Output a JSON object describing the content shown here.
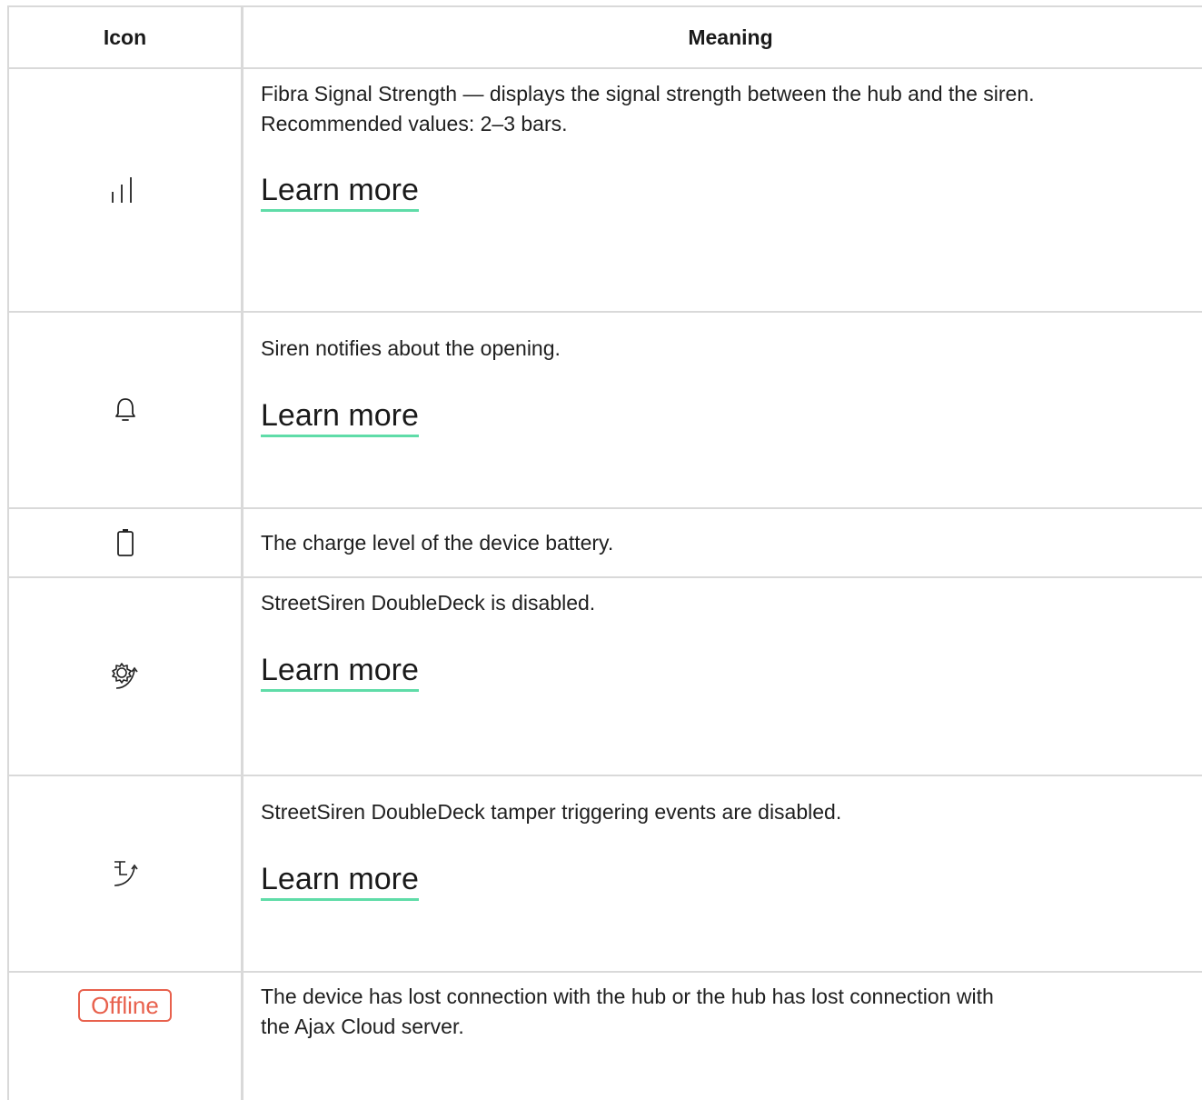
{
  "table": {
    "headers": {
      "icon": "Icon",
      "meaning": "Meaning"
    },
    "rows": [
      {
        "icon_name": "signal-strength-icon",
        "text_lines": [
          "Fibra Signal Strength — displays the signal strength between the hub and the siren.",
          "Recommended values: 2–3 bars."
        ],
        "link": "Learn more"
      },
      {
        "icon_name": "bell-icon",
        "text_lines": [
          "Siren notifies about the opening."
        ],
        "link": "Learn more"
      },
      {
        "icon_name": "battery-icon",
        "text_lines": [
          "The charge level of the device battery."
        ]
      },
      {
        "icon_name": "gear-disabled-icon",
        "text_lines": [
          "StreetSiren DoubleDeck is disabled."
        ],
        "link": "Learn more"
      },
      {
        "icon_name": "tamper-disabled-icon",
        "text_lines": [
          "StreetSiren DoubleDeck tamper triggering events are disabled."
        ],
        "link": "Learn more"
      },
      {
        "icon_name": "offline-badge",
        "badge": "Offline",
        "text_lines": [
          "The device has lost connection with the hub or the hub has lost connection with",
          "the Ajax Cloud server."
        ]
      }
    ]
  },
  "colors": {
    "border": "#d9d9d9",
    "link_underline": "#5fdca8",
    "offline": "#e8614d"
  }
}
